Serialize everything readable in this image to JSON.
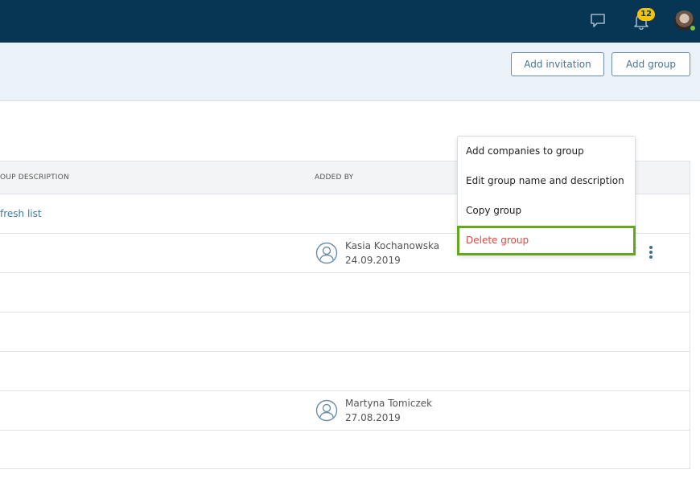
{
  "header": {
    "notification_count": "12",
    "icons": [
      "chat-icon",
      "bell-icon",
      "user-avatar"
    ]
  },
  "actions": {
    "add_invitation": "Add invitation",
    "add_group": "Add group"
  },
  "table": {
    "columns": [
      "OUP DESCRIPTION",
      "ADDED BY"
    ],
    "refresh_link": "fresh list",
    "rows": [
      {
        "added_by_name": "Kasia Kochanowska",
        "added_by_date": "24.09.2019"
      },
      {
        "added_by_name": "",
        "added_by_date": ""
      },
      {
        "added_by_name": "",
        "added_by_date": ""
      },
      {
        "added_by_name": "",
        "added_by_date": ""
      },
      {
        "added_by_name": "Martyna Tomiczek",
        "added_by_date": "27.08.2019"
      },
      {
        "added_by_name": "",
        "added_by_date": ""
      }
    ]
  },
  "context_menu": {
    "items": [
      {
        "label": "Add companies to group"
      },
      {
        "label": "Edit group name and description"
      },
      {
        "label": "Copy group"
      },
      {
        "label": "Delete group",
        "highlighted": true,
        "color": "#e2453c"
      }
    ],
    "highlight_color": "#62a81c"
  }
}
